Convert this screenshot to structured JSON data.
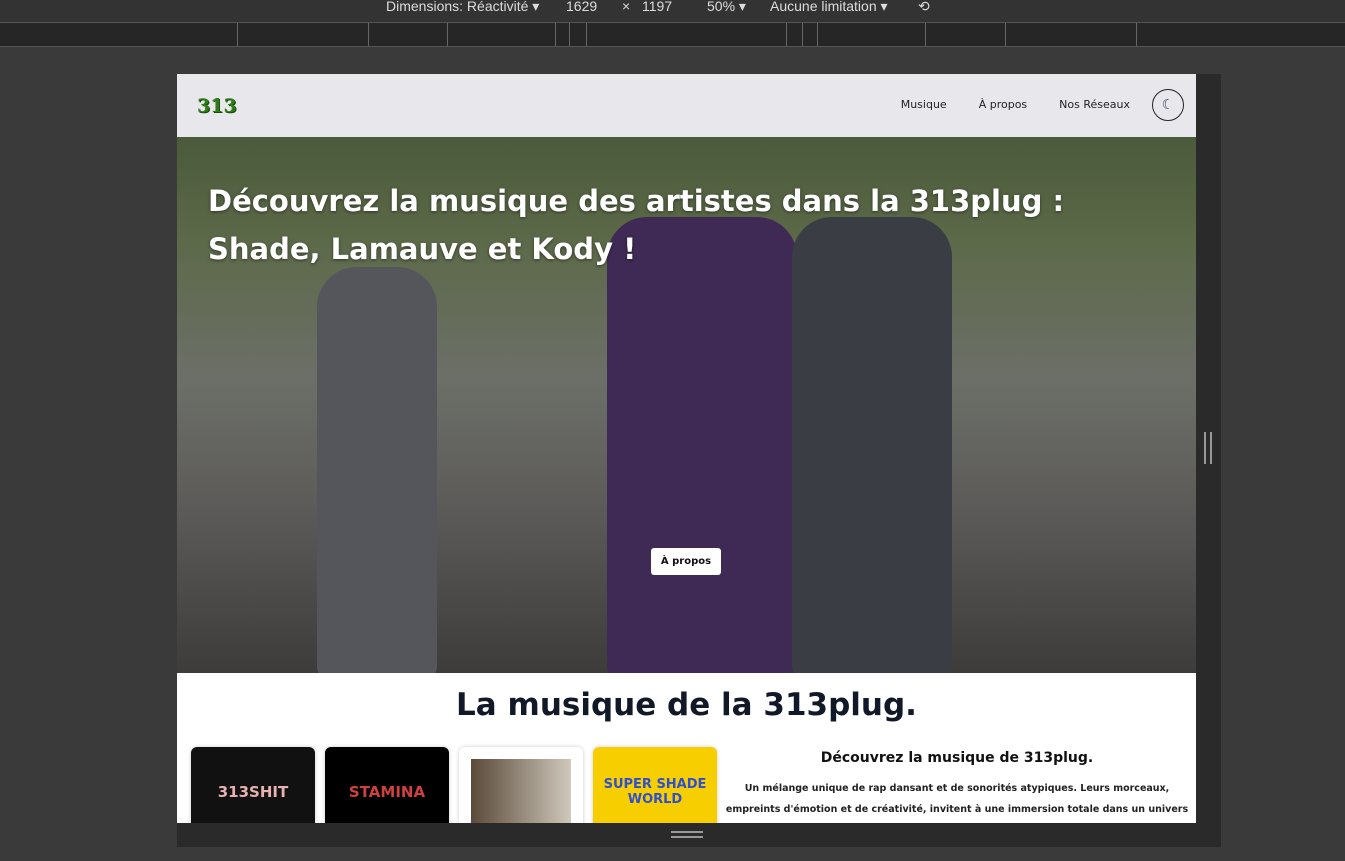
{
  "devtools": {
    "dimensions_label": "Dimensions: Réactivité ▾",
    "width": "1629",
    "times": "×",
    "height": "1197",
    "zoom": "50% ▾",
    "throttle": "Aucune limitation ▾",
    "rotate_icon": "rotate-icon"
  },
  "nav": {
    "logo": "313",
    "links": [
      "Musique",
      "À propos",
      "Nos Réseaux"
    ],
    "theme_icon": "◐"
  },
  "hero": {
    "title": "Découvrez la musique des artistes dans la 313plug : Shade, Lamauve et Kody !",
    "button": "À propos"
  },
  "music": {
    "title": "La musique de la 313plug.",
    "cards": [
      {
        "label": "313SHIT",
        "bg": "#111111",
        "color": "#e8b0b0"
      },
      {
        "label": "STAMINA",
        "bg": "#000000",
        "color": "#d04040"
      },
      {
        "label": "",
        "bg": "#e9e4da",
        "color": "#333"
      },
      {
        "label": "SUPER SHADE WORLD",
        "bg": "#f7cf00",
        "color": "#2f4fd1"
      }
    ],
    "desc_title": "Découvrez la musique de 313plug.",
    "desc_text": "Un mélange unique de rap dansant et de sonorités atypiques. Leurs morceaux, empreints d'émotion et de créativité, invitent à une immersion totale dans un univers où chaque note raconte une histoire."
  }
}
